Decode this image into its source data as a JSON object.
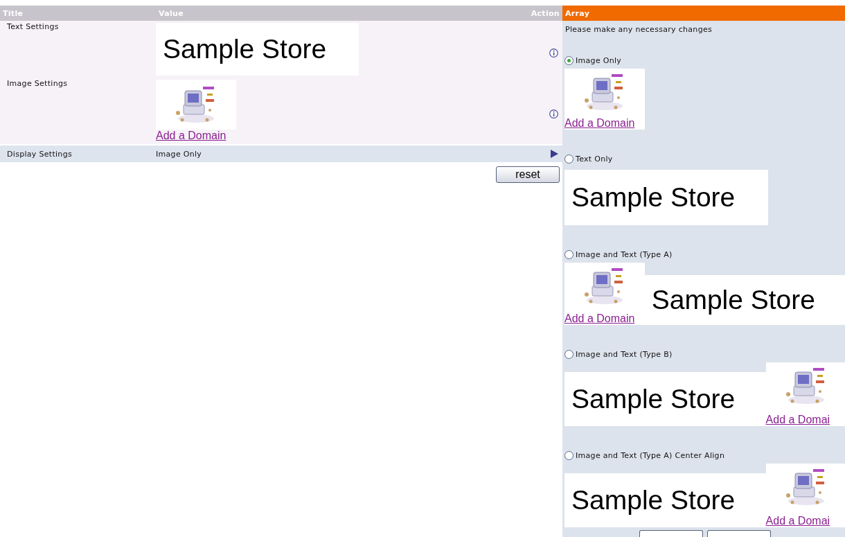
{
  "header": {
    "title": "Title",
    "value": "Value",
    "action": "Action",
    "array": "Array"
  },
  "settings": [
    {
      "kind": "text",
      "title": "Text Settings",
      "store": "Sample Store"
    },
    {
      "kind": "image",
      "title": "Image Settings",
      "link": "Add a Domain"
    },
    {
      "kind": "select",
      "title": "Display Settings",
      "value": "Image Only"
    }
  ],
  "reset": "reset",
  "panel": {
    "prompt": "Please make any necessary changes",
    "options": [
      {
        "kind": "image",
        "label": "Image Only",
        "selected": true,
        "link": "Add a Domain"
      },
      {
        "kind": "text",
        "label": "Text Only",
        "selected": false,
        "store": "Sample Store"
      },
      {
        "kind": "image-text",
        "label": "Image and Text (Type A)",
        "selected": false,
        "link": "Add a Domain",
        "store": "Sample Store"
      },
      {
        "kind": "text-image",
        "label": "Image and Text (Type B)",
        "selected": false,
        "link": "Add a Domai",
        "store": "Sample Store"
      },
      {
        "kind": "text-image",
        "label": "Image and Text (Type A) Center Align",
        "selected": false,
        "link": "Add a Domai",
        "store": "Sample Store"
      }
    ]
  }
}
